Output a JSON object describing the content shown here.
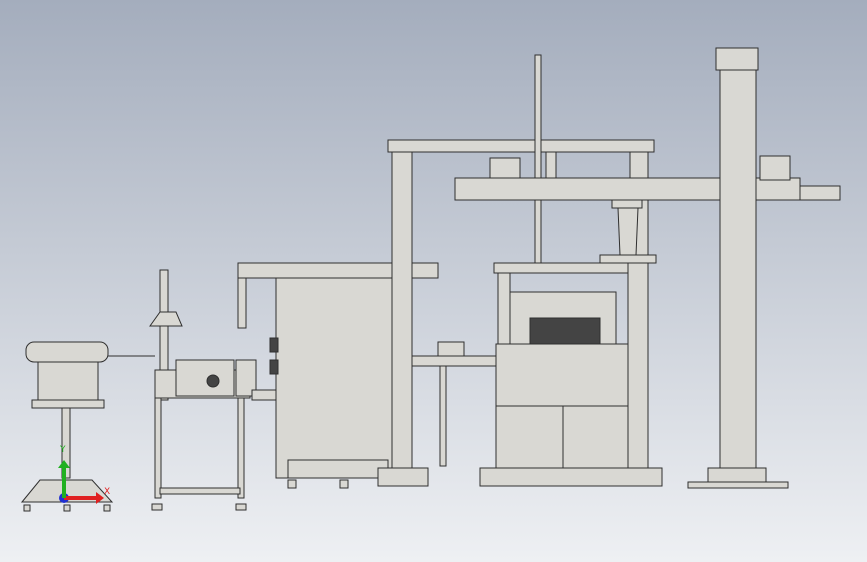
{
  "viewport": {
    "background_top": "#a4adbd",
    "background_bottom": "#eef0f3",
    "part_fill": "#d9d8d3",
    "part_stroke": "#2f2f2f",
    "dark_detail": "#444444"
  },
  "triad": {
    "x_label": "X",
    "y_label": "Y",
    "x_color": "#e02020",
    "y_color": "#20b020",
    "z_color": "#2030d0"
  }
}
